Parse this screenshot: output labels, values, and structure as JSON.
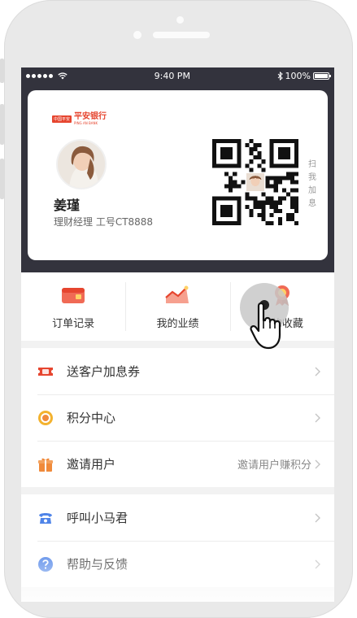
{
  "statusbar": {
    "time": "9:40 PM",
    "battery": "100%"
  },
  "profile": {
    "bank_badge": "中国平安",
    "bank_name": "平安银行",
    "bank_name_en": "PING AN BANK",
    "name": "姜瑾",
    "role_text": "理财经理   工号CT8888",
    "scan_hint": [
      "扫",
      "我",
      "加",
      "息"
    ]
  },
  "quick_actions": [
    {
      "label": "订单记录",
      "icon": "order-record-icon"
    },
    {
      "label": "我的业绩",
      "icon": "performance-chart-icon"
    },
    {
      "label": "我的收藏",
      "icon": "favorites-ribbon-icon"
    }
  ],
  "menu_group1": [
    {
      "label": "送客户加息券",
      "icon": "coupon-icon",
      "extra": ""
    },
    {
      "label": "积分中心",
      "icon": "points-icon",
      "extra": ""
    },
    {
      "label": "邀请用户",
      "icon": "gift-icon",
      "extra": "邀请用户赚积分"
    }
  ],
  "menu_group2": [
    {
      "label": "呼叫小马君",
      "icon": "phone-icon"
    },
    {
      "label": "帮助与反馈",
      "icon": "help-icon"
    }
  ],
  "colors": {
    "header_bg": "#33333d",
    "accent_red": "#e6452f",
    "points_yellow": "#f3b22e",
    "gift_orange": "#f08a3a",
    "help_blue": "#4f84e8"
  }
}
